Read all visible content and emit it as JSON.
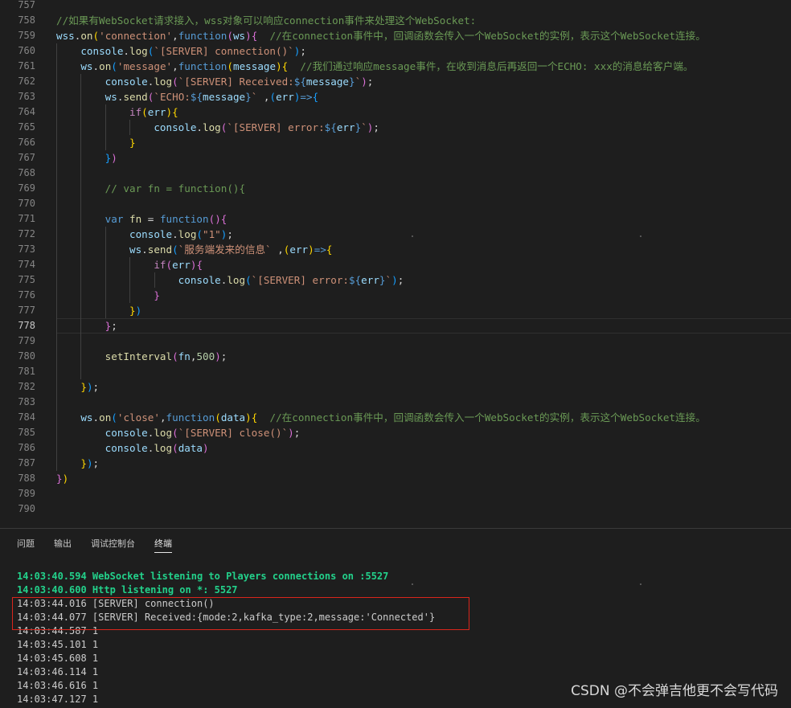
{
  "editor": {
    "active_line": 778,
    "lines": [
      {
        "n": 757,
        "indent": 0,
        "t": []
      },
      {
        "n": 758,
        "indent": 0,
        "t": [
          {
            "c": "cmt",
            "v": "//如果有WebSocket请求接入，wss对象可以响应connection事件来处理这个WebSocket:"
          }
        ]
      },
      {
        "n": 759,
        "indent": 0,
        "t": [
          {
            "c": "var",
            "v": "wss"
          },
          {
            "c": "def",
            "v": "."
          },
          {
            "c": "fn",
            "v": "on"
          },
          {
            "c": "p1",
            "v": "("
          },
          {
            "c": "str",
            "v": "'connection'"
          },
          {
            "c": "def",
            "v": ","
          },
          {
            "c": "kw",
            "v": "function"
          },
          {
            "c": "p2",
            "v": "("
          },
          {
            "c": "var",
            "v": "ws"
          },
          {
            "c": "p2",
            "v": ")"
          },
          {
            "c": "p2",
            "v": "{"
          },
          {
            "c": "def",
            "v": "  "
          },
          {
            "c": "cmt",
            "v": "//在connection事件中，回调函数会传入一个WebSocket的实例，表示这个WebSocket连接。"
          }
        ]
      },
      {
        "n": 760,
        "indent": 1,
        "t": [
          {
            "c": "var",
            "v": "console"
          },
          {
            "c": "def",
            "v": "."
          },
          {
            "c": "fn",
            "v": "log"
          },
          {
            "c": "p3",
            "v": "("
          },
          {
            "c": "str",
            "v": "`[SERVER] connection()`"
          },
          {
            "c": "p3",
            "v": ")"
          },
          {
            "c": "def",
            "v": ";"
          }
        ]
      },
      {
        "n": 761,
        "indent": 1,
        "t": [
          {
            "c": "var",
            "v": "ws"
          },
          {
            "c": "def",
            "v": "."
          },
          {
            "c": "fn",
            "v": "on"
          },
          {
            "c": "p3",
            "v": "("
          },
          {
            "c": "str",
            "v": "'message'"
          },
          {
            "c": "def",
            "v": ","
          },
          {
            "c": "kw",
            "v": "function"
          },
          {
            "c": "p1",
            "v": "("
          },
          {
            "c": "var",
            "v": "message"
          },
          {
            "c": "p1",
            "v": ")"
          },
          {
            "c": "p1",
            "v": "{"
          },
          {
            "c": "def",
            "v": "  "
          },
          {
            "c": "cmt",
            "v": "//我们通过响应message事件，在收到消息后再返回一个ECHO: xxx的消息给客户端。"
          }
        ]
      },
      {
        "n": 762,
        "indent": 2,
        "t": [
          {
            "c": "var",
            "v": "console"
          },
          {
            "c": "def",
            "v": "."
          },
          {
            "c": "fn",
            "v": "log"
          },
          {
            "c": "p2",
            "v": "("
          },
          {
            "c": "str",
            "v": "`[SERVER] Received:"
          },
          {
            "c": "kw",
            "v": "${"
          },
          {
            "c": "var",
            "v": "message"
          },
          {
            "c": "kw",
            "v": "}"
          },
          {
            "c": "str",
            "v": "`"
          },
          {
            "c": "p2",
            "v": ")"
          },
          {
            "c": "def",
            "v": ";"
          }
        ]
      },
      {
        "n": 763,
        "indent": 2,
        "t": [
          {
            "c": "var",
            "v": "ws"
          },
          {
            "c": "def",
            "v": "."
          },
          {
            "c": "fn",
            "v": "send"
          },
          {
            "c": "p2",
            "v": "("
          },
          {
            "c": "str",
            "v": "`ECHO:"
          },
          {
            "c": "kw",
            "v": "${"
          },
          {
            "c": "var",
            "v": "message"
          },
          {
            "c": "kw",
            "v": "}"
          },
          {
            "c": "str",
            "v": "`"
          },
          {
            "c": "def",
            "v": " ,"
          },
          {
            "c": "p3",
            "v": "("
          },
          {
            "c": "var",
            "v": "err"
          },
          {
            "c": "p3",
            "v": ")"
          },
          {
            "c": "kw",
            "v": "=>"
          },
          {
            "c": "p3",
            "v": "{"
          }
        ]
      },
      {
        "n": 764,
        "indent": 3,
        "t": [
          {
            "c": "ctl",
            "v": "if"
          },
          {
            "c": "p1",
            "v": "("
          },
          {
            "c": "var",
            "v": "err"
          },
          {
            "c": "p1",
            "v": ")"
          },
          {
            "c": "p1",
            "v": "{"
          }
        ]
      },
      {
        "n": 765,
        "indent": 4,
        "t": [
          {
            "c": "var",
            "v": "console"
          },
          {
            "c": "def",
            "v": "."
          },
          {
            "c": "fn",
            "v": "log"
          },
          {
            "c": "p2",
            "v": "("
          },
          {
            "c": "str",
            "v": "`[SERVER] error:"
          },
          {
            "c": "kw",
            "v": "${"
          },
          {
            "c": "var",
            "v": "err"
          },
          {
            "c": "kw",
            "v": "}"
          },
          {
            "c": "str",
            "v": "`"
          },
          {
            "c": "p2",
            "v": ")"
          },
          {
            "c": "def",
            "v": ";"
          }
        ]
      },
      {
        "n": 766,
        "indent": 3,
        "t": [
          {
            "c": "p1",
            "v": "}"
          }
        ]
      },
      {
        "n": 767,
        "indent": 2,
        "t": [
          {
            "c": "p3",
            "v": "}"
          },
          {
            "c": "p2",
            "v": ")"
          }
        ]
      },
      {
        "n": 768,
        "indent": 0,
        "t": []
      },
      {
        "n": 769,
        "indent": 2,
        "t": [
          {
            "c": "cmt",
            "v": "// var fn = function(){"
          }
        ]
      },
      {
        "n": 770,
        "indent": 0,
        "t": []
      },
      {
        "n": 771,
        "indent": 2,
        "t": [
          {
            "c": "kw",
            "v": "var"
          },
          {
            "c": "def",
            "v": " "
          },
          {
            "c": "fn",
            "v": "fn"
          },
          {
            "c": "def",
            "v": " = "
          },
          {
            "c": "kw",
            "v": "function"
          },
          {
            "c": "p2",
            "v": "()"
          },
          {
            "c": "p2",
            "v": "{"
          }
        ]
      },
      {
        "n": 772,
        "indent": 3,
        "t": [
          {
            "c": "var",
            "v": "console"
          },
          {
            "c": "def",
            "v": "."
          },
          {
            "c": "fn",
            "v": "log"
          },
          {
            "c": "p3",
            "v": "("
          },
          {
            "c": "str",
            "v": "\"1\""
          },
          {
            "c": "p3",
            "v": ")"
          },
          {
            "c": "def",
            "v": ";"
          }
        ]
      },
      {
        "n": 773,
        "indent": 3,
        "t": [
          {
            "c": "var",
            "v": "ws"
          },
          {
            "c": "def",
            "v": "."
          },
          {
            "c": "fn",
            "v": "send"
          },
          {
            "c": "p3",
            "v": "("
          },
          {
            "c": "str",
            "v": "`服务端发来的信息`"
          },
          {
            "c": "def",
            "v": " ,"
          },
          {
            "c": "p1",
            "v": "("
          },
          {
            "c": "var",
            "v": "err"
          },
          {
            "c": "p1",
            "v": ")"
          },
          {
            "c": "kw",
            "v": "=>"
          },
          {
            "c": "p1",
            "v": "{"
          }
        ]
      },
      {
        "n": 774,
        "indent": 4,
        "t": [
          {
            "c": "ctl",
            "v": "if"
          },
          {
            "c": "p2",
            "v": "("
          },
          {
            "c": "var",
            "v": "err"
          },
          {
            "c": "p2",
            "v": ")"
          },
          {
            "c": "p2",
            "v": "{"
          }
        ]
      },
      {
        "n": 775,
        "indent": 5,
        "t": [
          {
            "c": "var",
            "v": "console"
          },
          {
            "c": "def",
            "v": "."
          },
          {
            "c": "fn",
            "v": "log"
          },
          {
            "c": "p3",
            "v": "("
          },
          {
            "c": "str",
            "v": "`[SERVER] error:"
          },
          {
            "c": "kw",
            "v": "${"
          },
          {
            "c": "var",
            "v": "err"
          },
          {
            "c": "kw",
            "v": "}"
          },
          {
            "c": "str",
            "v": "`"
          },
          {
            "c": "p3",
            "v": ")"
          },
          {
            "c": "def",
            "v": ";"
          }
        ]
      },
      {
        "n": 776,
        "indent": 4,
        "t": [
          {
            "c": "p2",
            "v": "}"
          }
        ]
      },
      {
        "n": 777,
        "indent": 3,
        "t": [
          {
            "c": "p1",
            "v": "}"
          },
          {
            "c": "p3",
            "v": ")"
          }
        ]
      },
      {
        "n": 778,
        "indent": 2,
        "t": [
          {
            "c": "p2",
            "v": "}"
          },
          {
            "c": "def",
            "v": ";"
          }
        ]
      },
      {
        "n": 779,
        "indent": 0,
        "t": []
      },
      {
        "n": 780,
        "indent": 2,
        "t": [
          {
            "c": "fn",
            "v": "setInterval"
          },
          {
            "c": "p2",
            "v": "("
          },
          {
            "c": "var",
            "v": "fn"
          },
          {
            "c": "def",
            "v": ","
          },
          {
            "c": "num",
            "v": "500"
          },
          {
            "c": "p2",
            "v": ")"
          },
          {
            "c": "def",
            "v": ";"
          }
        ]
      },
      {
        "n": 781,
        "indent": 0,
        "t": []
      },
      {
        "n": 782,
        "indent": 1,
        "t": [
          {
            "c": "p1",
            "v": "}"
          },
          {
            "c": "p3",
            "v": ")"
          },
          {
            "c": "def",
            "v": ";"
          }
        ]
      },
      {
        "n": 783,
        "indent": 0,
        "t": []
      },
      {
        "n": 784,
        "indent": 1,
        "t": [
          {
            "c": "var",
            "v": "ws"
          },
          {
            "c": "def",
            "v": "."
          },
          {
            "c": "fn",
            "v": "on"
          },
          {
            "c": "p3",
            "v": "("
          },
          {
            "c": "str",
            "v": "'close'"
          },
          {
            "c": "def",
            "v": ","
          },
          {
            "c": "kw",
            "v": "function"
          },
          {
            "c": "p1",
            "v": "("
          },
          {
            "c": "var",
            "v": "data"
          },
          {
            "c": "p1",
            "v": ")"
          },
          {
            "c": "p1",
            "v": "{"
          },
          {
            "c": "def",
            "v": "  "
          },
          {
            "c": "cmt",
            "v": "//在connection事件中，回调函数会传入一个WebSocket的实例，表示这个WebSocket连接。"
          }
        ]
      },
      {
        "n": 785,
        "indent": 2,
        "t": [
          {
            "c": "var",
            "v": "console"
          },
          {
            "c": "def",
            "v": "."
          },
          {
            "c": "fn",
            "v": "log"
          },
          {
            "c": "p2",
            "v": "("
          },
          {
            "c": "str",
            "v": "`[SERVER] close()`"
          },
          {
            "c": "p2",
            "v": ")"
          },
          {
            "c": "def",
            "v": ";"
          }
        ]
      },
      {
        "n": 786,
        "indent": 2,
        "t": [
          {
            "c": "var",
            "v": "console"
          },
          {
            "c": "def",
            "v": "."
          },
          {
            "c": "fn",
            "v": "log"
          },
          {
            "c": "p2",
            "v": "("
          },
          {
            "c": "var",
            "v": "data"
          },
          {
            "c": "p2",
            "v": ")"
          }
        ]
      },
      {
        "n": 787,
        "indent": 1,
        "t": [
          {
            "c": "p1",
            "v": "}"
          },
          {
            "c": "p3",
            "v": ")"
          },
          {
            "c": "def",
            "v": ";"
          }
        ]
      },
      {
        "n": 788,
        "indent": 0,
        "t": [
          {
            "c": "p2",
            "v": "}"
          },
          {
            "c": "p1",
            "v": ")"
          }
        ]
      },
      {
        "n": 789,
        "indent": 0,
        "t": []
      },
      {
        "n": 790,
        "indent": 0,
        "t": []
      }
    ]
  },
  "panel": {
    "tabs": [
      {
        "label": "问题",
        "active": false
      },
      {
        "label": "输出",
        "active": false
      },
      {
        "label": "调试控制台",
        "active": false
      },
      {
        "label": "终端",
        "active": true
      }
    ],
    "terminal_lines": [
      {
        "text": "14:03:40.594 WebSocket listening to Players connections on :5527",
        "style": "green"
      },
      {
        "text": "14:03:40.600 Http listening on *: 5527",
        "style": "green"
      },
      {
        "text": "14:03:44.016 [SERVER] connection()",
        "style": "plain"
      },
      {
        "text": "14:03:44.077 [SERVER] Received:{mode:2,kafka_type:2,message:'Connected'}",
        "style": "plain"
      },
      {
        "text": "14:03:44.587 1",
        "style": "plain"
      },
      {
        "text": "14:03:45.101 1",
        "style": "plain"
      },
      {
        "text": "14:03:45.608 1",
        "style": "plain"
      },
      {
        "text": "14:03:46.114 1",
        "style": "plain"
      },
      {
        "text": "14:03:46.616 1",
        "style": "plain"
      },
      {
        "text": "14:03:47.127 1",
        "style": "plain"
      }
    ]
  },
  "watermark": "CSDN @不会弹吉他更不会写代码",
  "colors": {
    "highlight_box": "#d9261c",
    "terminal_green": "#23d18b"
  }
}
